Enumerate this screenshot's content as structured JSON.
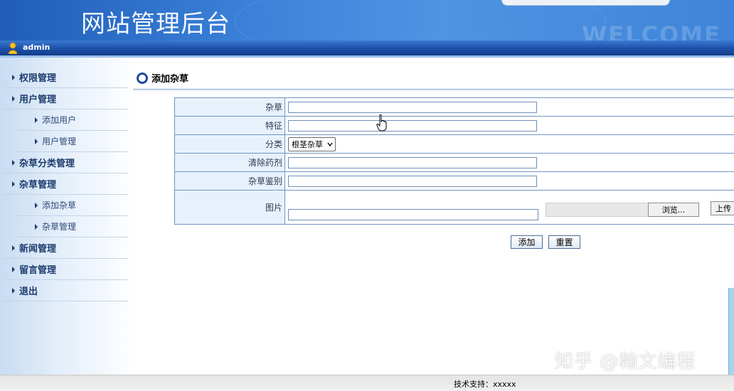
{
  "header": {
    "site_title": "网站管理后台",
    "welcome_text": "WELCOME"
  },
  "user": {
    "name": "admin"
  },
  "sidebar": {
    "items": [
      {
        "label": "权限管理",
        "level": "main"
      },
      {
        "label": "用户管理",
        "level": "main"
      },
      {
        "label": "添加用户",
        "level": "sub"
      },
      {
        "label": "用户管理",
        "level": "sub"
      },
      {
        "label": "杂草分类管理",
        "level": "main"
      },
      {
        "label": "杂草管理",
        "level": "main"
      },
      {
        "label": "添加杂草",
        "level": "sub"
      },
      {
        "label": "杂草管理",
        "level": "sub"
      },
      {
        "label": "新闻管理",
        "level": "main"
      },
      {
        "label": "留言管理",
        "level": "main"
      },
      {
        "label": "退出",
        "level": "main"
      }
    ]
  },
  "main": {
    "section_title": "添加杂草",
    "form": {
      "weed_label": "杂草",
      "weed_value": "",
      "feature_label": "特征",
      "feature_value": "",
      "category_label": "分类",
      "category_selected": "根茎杂草",
      "herbicide_label": "清除药剂",
      "herbicide_value": "",
      "identify_label": "杂草鉴别",
      "identify_value": "",
      "image_label": "图片",
      "image_value": "",
      "browse_label": "浏览...",
      "upload_label": "上传"
    },
    "add_button": "添加",
    "reset_button": "重置"
  },
  "footer": {
    "support_text": "技术支持：xxxxx",
    "watermark": "知乎 @翰文编程"
  },
  "colors": {
    "header_blue": "#3c82da",
    "nav_dark_blue": "#1c4fa7",
    "sidebar_bg": "#d9e7f7",
    "label_bg": "#e8f1fb",
    "table_border": "#6f95c6"
  }
}
